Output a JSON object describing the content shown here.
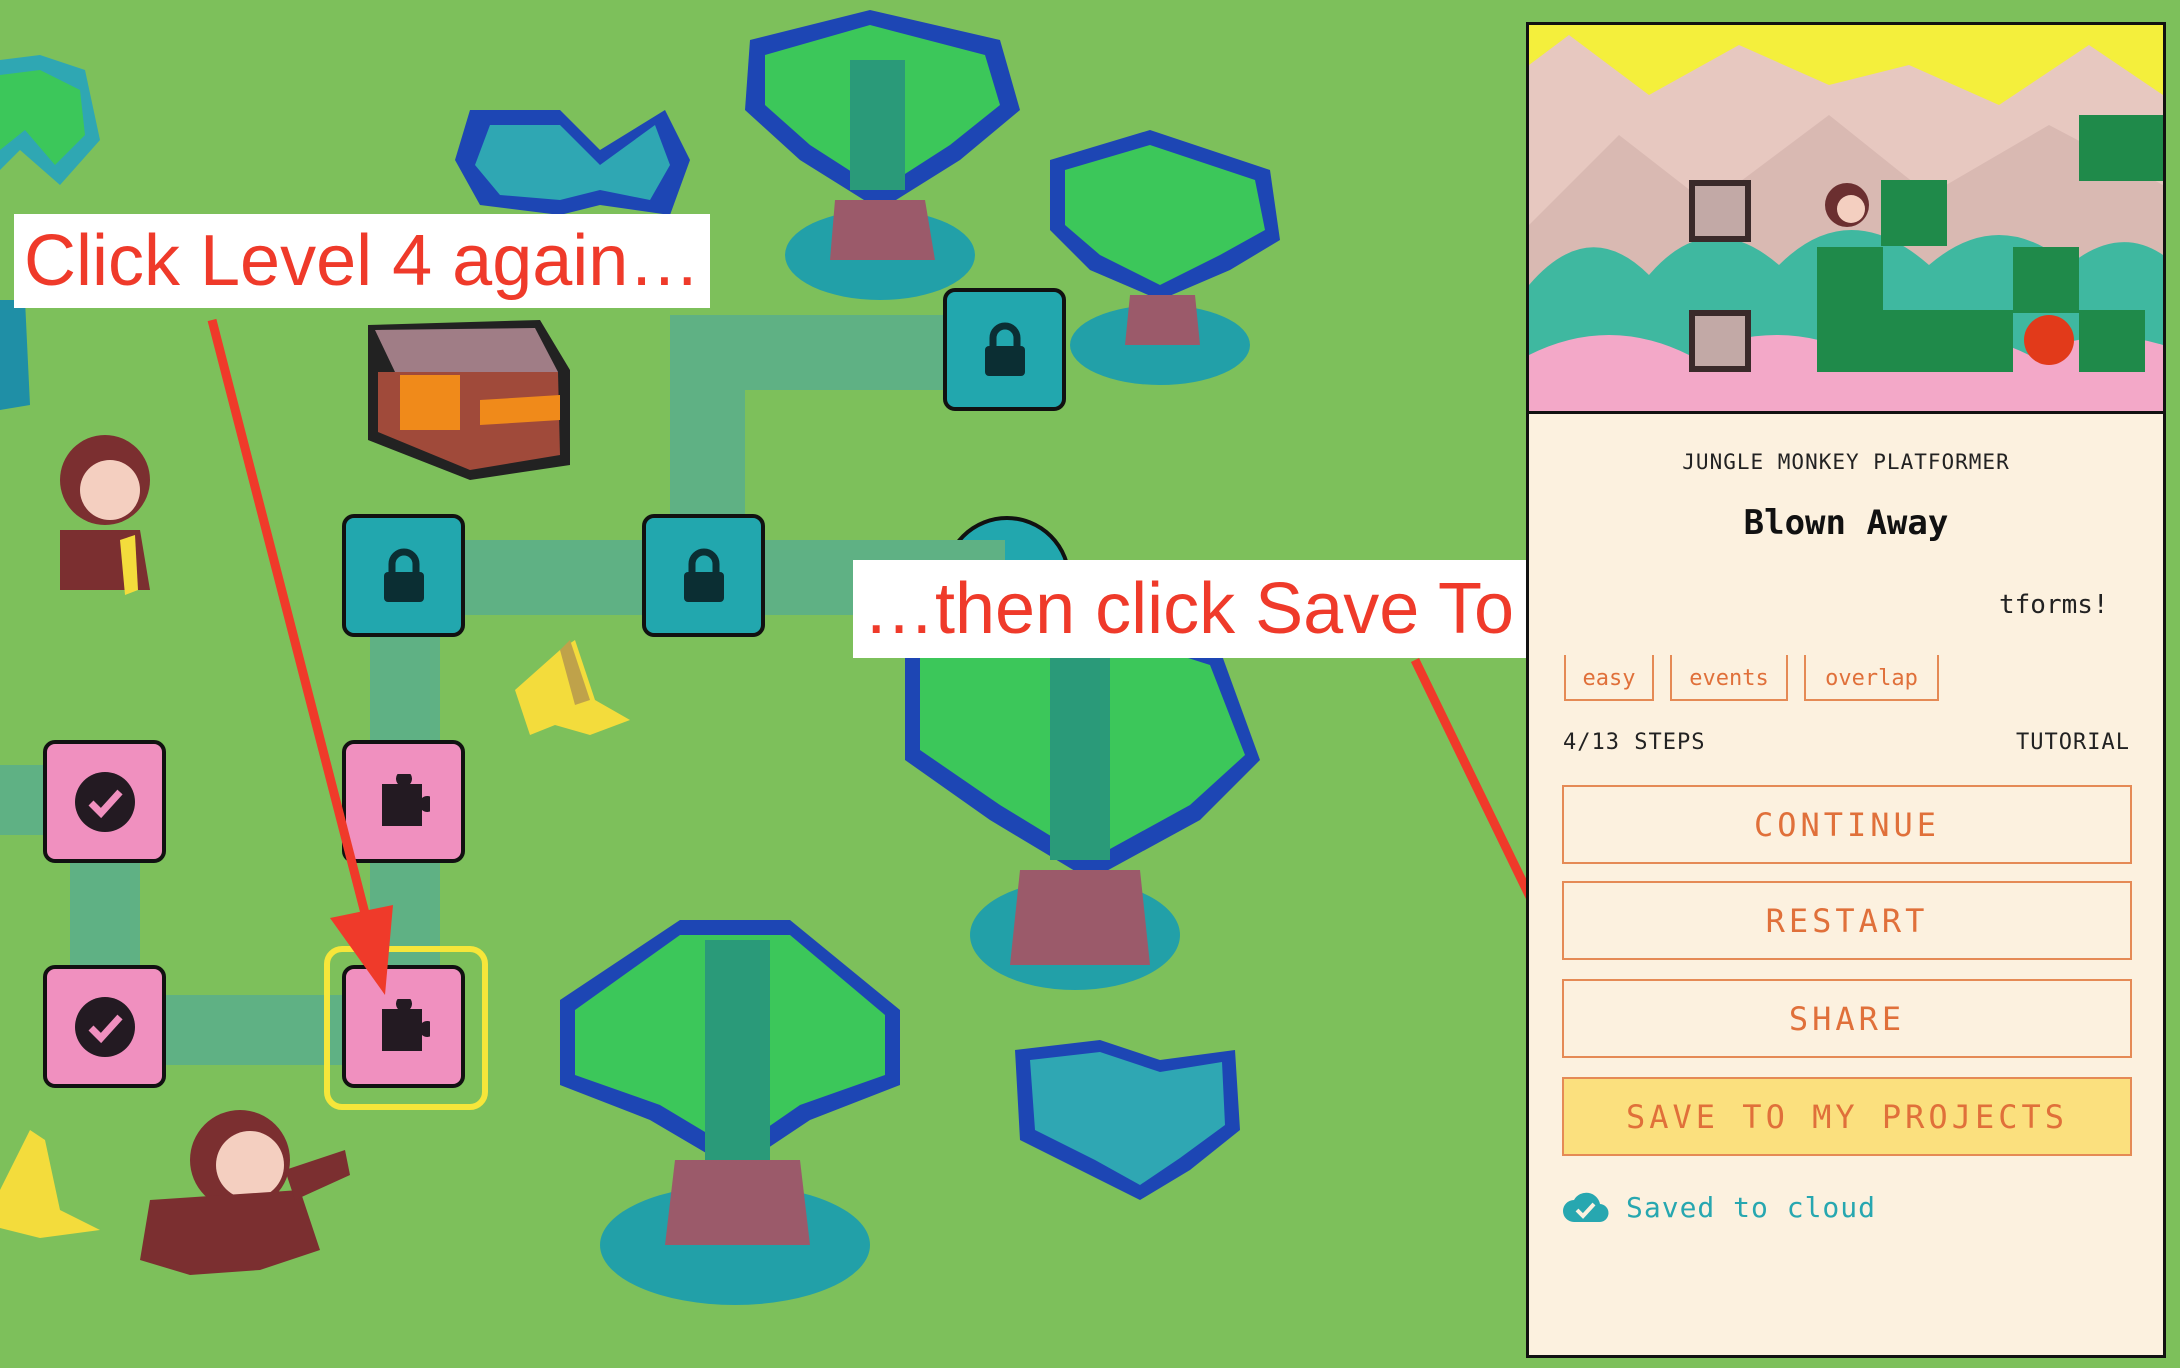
{
  "callouts": {
    "first": "Click Level 4 again…",
    "second": "…then click Save To My Projects",
    "color": "#ef3a2a"
  },
  "map": {
    "background_color": "#7dc05b",
    "path_color": "#5fb184",
    "nodes": [
      {
        "id": "node-locked-1",
        "state": "locked",
        "icon": "lock-icon"
      },
      {
        "id": "node-locked-2",
        "state": "locked",
        "icon": "lock-icon"
      },
      {
        "id": "node-locked-3",
        "state": "locked",
        "icon": "lock-icon"
      },
      {
        "id": "node-locked-4",
        "state": "locked",
        "icon": "lock-icon"
      },
      {
        "id": "node-done-1",
        "state": "completed",
        "icon": "checkmark-icon"
      },
      {
        "id": "node-done-2",
        "state": "completed",
        "icon": "checkmark-icon"
      },
      {
        "id": "node-puzzle-upper",
        "state": "available",
        "icon": "puzzle-icon"
      },
      {
        "id": "node-level-4",
        "state": "selected",
        "icon": "puzzle-icon"
      }
    ],
    "selected_highlight_color": "#f6e63a"
  },
  "panel": {
    "eyebrow": "JUNGLE MONKEY PLATFORMER",
    "title": "Blown Away",
    "description_visible_tail": "tforms!",
    "tags": [
      "easy",
      "events",
      "overlap"
    ],
    "steps": "4/13 STEPS",
    "mode": "TUTORIAL",
    "buttons": {
      "continue": "CONTINUE",
      "restart": "RESTART",
      "share": "SHARE",
      "save": "SAVE TO MY PROJECTS"
    },
    "status": "Saved to cloud",
    "accent_color": "#e0703a",
    "save_button_color": "#fbe07e",
    "status_color": "#27a7b0"
  }
}
